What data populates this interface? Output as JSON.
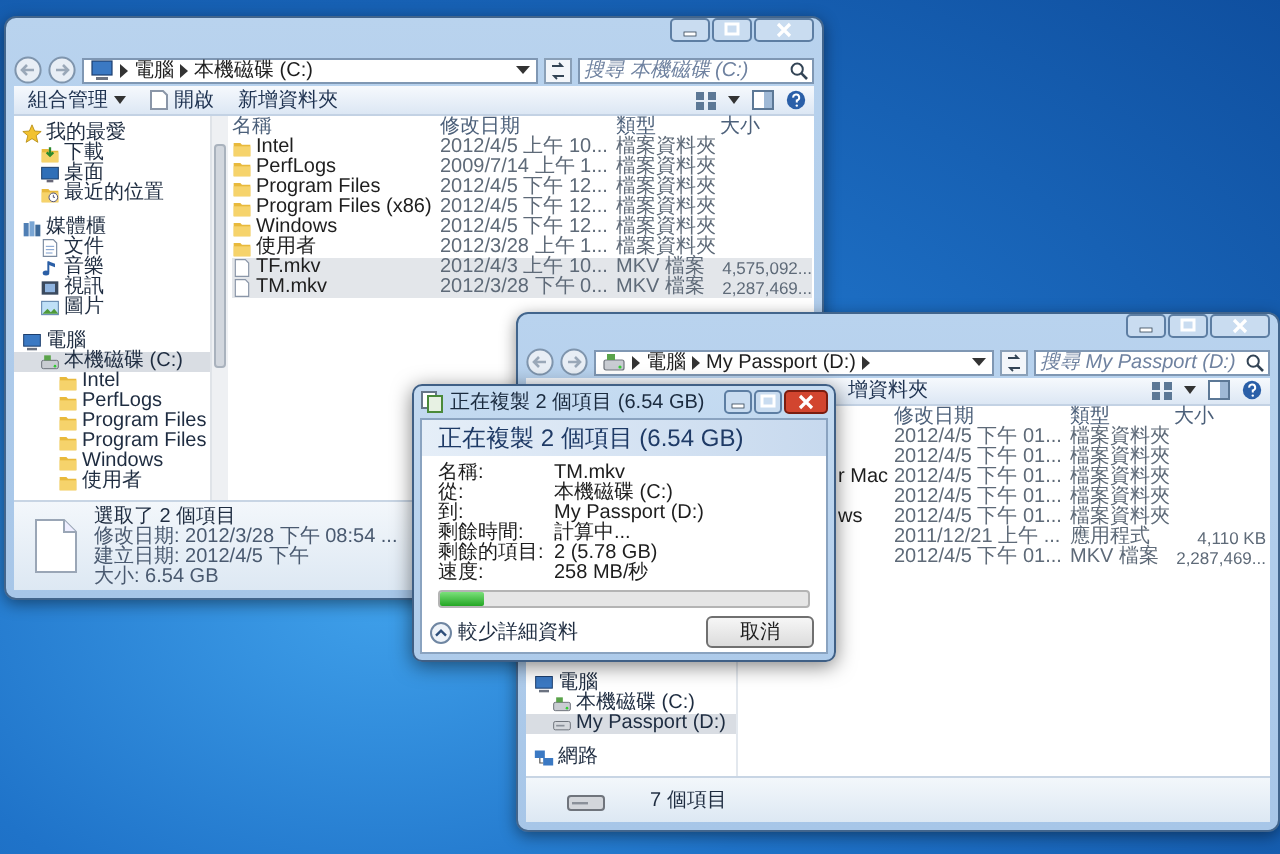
{
  "windows": [
    {
      "address": {
        "kind": "computer",
        "segments": [
          "電腦",
          "本機磁碟 (C:)"
        ],
        "trailing_arrow": false
      },
      "search": {
        "placeholder": "搜尋 本機磁碟 (C:)"
      },
      "toolbar": [
        {
          "label": "組合管理",
          "kind": "menu"
        },
        {
          "label": "開啟",
          "kind": "open"
        },
        {
          "label": "新增資料夾",
          "kind": "plain"
        }
      ],
      "nav_scrollbar": true,
      "nav": [
        {
          "label": "我的最愛",
          "kind": "star",
          "selected": false,
          "children": [
            {
              "label": "下載",
              "kind": "download",
              "selected": false
            },
            {
              "label": "桌面",
              "kind": "desktop",
              "selected": false
            },
            {
              "label": "最近的位置",
              "kind": "recent",
              "selected": false
            }
          ]
        },
        {
          "label": "媒體櫃",
          "kind": "library",
          "selected": false,
          "children": [
            {
              "label": "文件",
              "kind": "document",
              "selected": false
            },
            {
              "label": "音樂",
              "kind": "music",
              "selected": false
            },
            {
              "label": "視訊",
              "kind": "video",
              "selected": false
            },
            {
              "label": "圖片",
              "kind": "picture",
              "selected": false
            }
          ]
        },
        {
          "label": "電腦",
          "kind": "computer",
          "selected": false,
          "children": [
            {
              "label": "本機磁碟 (C:)",
              "kind": "drive",
              "selected": true,
              "children": [
                {
                  "label": "Intel",
                  "kind": "folder",
                  "selected": false
                },
                {
                  "label": "PerfLogs",
                  "kind": "folder",
                  "selected": false
                },
                {
                  "label": "Program Files",
                  "kind": "folder",
                  "selected": false
                },
                {
                  "label": "Program Files",
                  "kind": "folder",
                  "selected": false
                },
                {
                  "label": "Windows",
                  "kind": "folder",
                  "selected": false
                },
                {
                  "label": "使用者",
                  "kind": "folder",
                  "selected": false
                }
              ]
            }
          ]
        }
      ],
      "columns": [
        "名稱",
        "修改日期",
        "類型",
        "大小"
      ],
      "rows": [
        {
          "kind": "folder",
          "name": "Intel",
          "modified": "2012/4/5 上午 10...",
          "type": "檔案資料夾",
          "selected": false
        },
        {
          "kind": "folder",
          "name": "PerfLogs",
          "modified": "2009/7/14 上午 1...",
          "type": "檔案資料夾",
          "selected": false
        },
        {
          "kind": "folder",
          "name": "Program Files",
          "modified": "2012/4/5 下午 12...",
          "type": "檔案資料夾",
          "selected": false
        },
        {
          "kind": "folder",
          "name": "Program Files (x86)",
          "modified": "2012/4/5 下午 12...",
          "type": "檔案資料夾",
          "selected": false
        },
        {
          "kind": "folder",
          "name": "Windows",
          "modified": "2012/4/5 下午 12...",
          "type": "檔案資料夾",
          "selected": false
        },
        {
          "kind": "folder",
          "name": "使用者",
          "modified": "2012/3/28 上午 1...",
          "type": "檔案資料夾",
          "selected": false
        },
        {
          "kind": "file",
          "name": "TF.mkv",
          "modified": "2012/4/3 上午 10...",
          "type": "MKV 檔案",
          "size": "4,575,092...",
          "selected": true
        },
        {
          "kind": "file",
          "name": "TM.mkv",
          "modified": "2012/3/28 下午 0...",
          "type": "MKV 檔案",
          "size": "2,287,469...",
          "selected": true
        }
      ],
      "details": {
        "title": "選取了 2 個項目",
        "properties": [
          "修改日期: 2012/3/28 下午 08:54 ...",
          "建立日期: 2012/4/5 下午",
          "大小: 6.54 GB"
        ]
      }
    },
    {
      "address": {
        "kind": "drive",
        "segments": [
          "電腦",
          "My Passport (D:)"
        ],
        "trailing_arrow": true
      },
      "search": {
        "placeholder": "搜尋 My Passport (D:)"
      },
      "toolbar": [
        {
          "label": "增資料夾",
          "kind": "plain"
        }
      ],
      "nav": [
        {
          "label": "電腦",
          "kind": "computer",
          "selected": false,
          "children": [
            {
              "label": "本機磁碟 (C:)",
              "kind": "drive",
              "selected": false
            },
            {
              "label": "My Passport (D:)",
              "kind": "usb-drive",
              "selected": true
            }
          ]
        },
        {
          "label": "網路",
          "kind": "network",
          "selected": false
        }
      ],
      "columns": [
        "修改日期",
        "類型",
        "大小"
      ],
      "rows": [
        {
          "modified": "2012/4/5 下午 01...",
          "type": "檔案資料夾",
          "selected": false
        },
        {
          "modified": "2012/4/5 下午 01...",
          "type": "檔案資料夾",
          "selected": false
        },
        {
          "name": "r Mac",
          "modified": "2012/4/5 下午 01...",
          "type": "檔案資料夾",
          "selected": false
        },
        {
          "modified": "2012/4/5 下午 01...",
          "type": "檔案資料夾",
          "selected": false
        },
        {
          "name": "ws",
          "modified": "2012/4/5 下午 01...",
          "type": "檔案資料夾",
          "selected": false
        },
        {
          "modified": "2011/12/21 上午 ...",
          "type": "應用程式",
          "size": "4,110 KB",
          "selected": false
        },
        {
          "modified": "2012/4/5 下午 01...",
          "type": "MKV 檔案",
          "size": "2,287,469...",
          "selected": false
        }
      ],
      "status": {
        "text": "7 個項目"
      }
    }
  ],
  "dialog": {
    "title": "正在複製 2 個項目 (6.54 GB)",
    "heading": "正在複製 2 個項目 (6.54 GB)",
    "fields": [
      {
        "label": "名稱:",
        "value": "TM.mkv"
      },
      {
        "label": "從:",
        "value": "本機磁碟 (C:)"
      },
      {
        "label": "到:",
        "value": "My Passport (D:)"
      },
      {
        "label": "剩餘時間:",
        "value": "計算中..."
      },
      {
        "label": "剩餘的項目:",
        "value": "2 (5.78 GB)"
      },
      {
        "label": "速度:",
        "value": "258 MB/秒"
      }
    ],
    "progress": {
      "level": 0.12
    },
    "details_button": "較少詳細資料",
    "cancel_button": "取消"
  }
}
